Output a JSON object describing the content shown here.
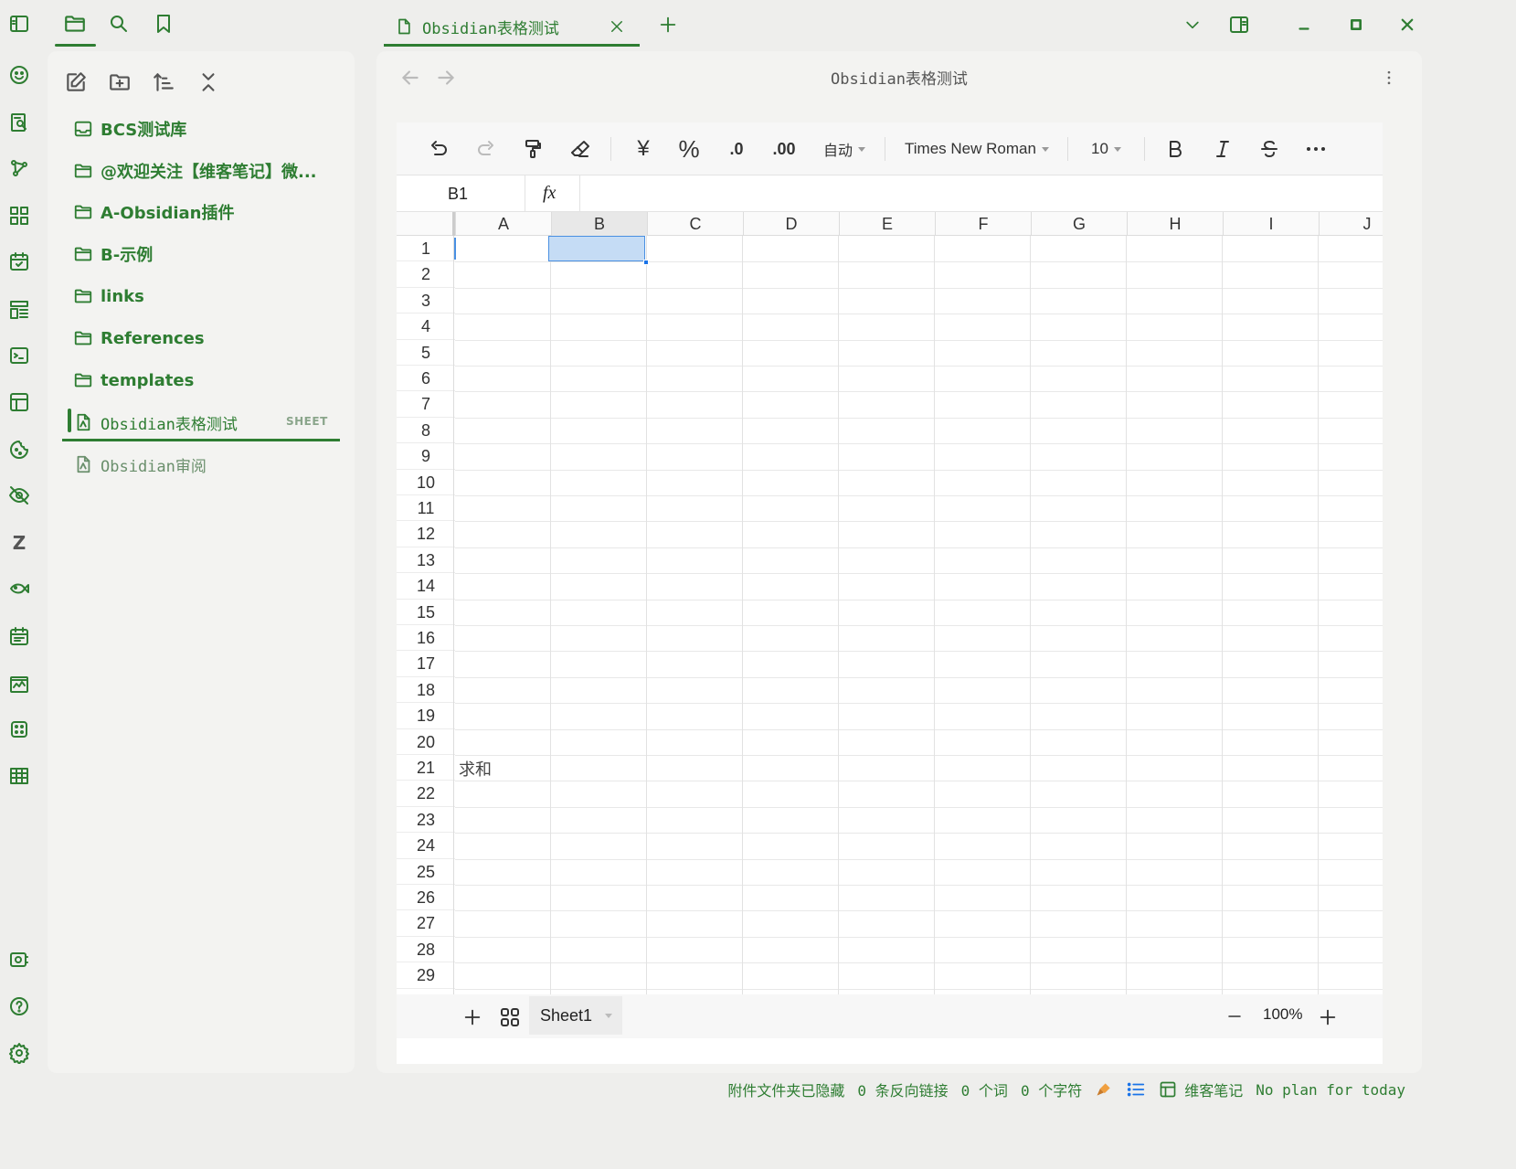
{
  "sidebar_left": {
    "tabs": [
      "files-icon",
      "search-icon",
      "bookmark-icon"
    ],
    "nav_icons": [
      "new-note-icon",
      "new-folder-icon",
      "sort-icon",
      "collapse-icon"
    ],
    "items": [
      {
        "label": "BCS测试库",
        "type": "vault"
      },
      {
        "label": "@欢迎关注【维客笔记】微...",
        "type": "folder"
      },
      {
        "label": "A-Obsidian插件",
        "type": "folder"
      },
      {
        "label": "B-示例",
        "type": "folder"
      },
      {
        "label": "links",
        "type": "folder"
      },
      {
        "label": "References",
        "type": "folder"
      },
      {
        "label": "templates",
        "type": "folder"
      },
      {
        "label": "Obsidian表格测试",
        "type": "file",
        "badge": "SHEET",
        "active": true
      },
      {
        "label": "Obsidian审阅",
        "type": "file"
      }
    ]
  },
  "tab": {
    "title": "Obsidian表格测试"
  },
  "view": {
    "title": "Obsidian表格测试"
  },
  "toolbar": {
    "number_format": "自动",
    "font": "Times New Roman",
    "font_size": "10",
    "currency": "¥",
    "percent": "%",
    "dec_less": ".0",
    "dec_more": ".00"
  },
  "formula_bar": {
    "cell_ref": "B1",
    "fx": "fx"
  },
  "grid": {
    "columns": [
      "A",
      "B",
      "C",
      "D",
      "E",
      "F",
      "G",
      "H",
      "I",
      "J"
    ],
    "rows": [
      "1",
      "2",
      "3",
      "4",
      "5",
      "6",
      "7",
      "8",
      "9",
      "10",
      "11",
      "12",
      "13",
      "14",
      "15",
      "16",
      "17",
      "18",
      "19",
      "20",
      "21",
      "22",
      "23",
      "24",
      "25",
      "26",
      "27",
      "28",
      "29"
    ],
    "selected_cell": "B1",
    "cells": {
      "A21": "求和"
    }
  },
  "footer": {
    "sheet_name": "Sheet1",
    "zoom": "100%"
  },
  "status": {
    "attachments": "附件文件夹已隐藏",
    "backlinks": "0 条反向链接",
    "words": "0 个词",
    "chars": "0 个字符",
    "plugin": "维客笔记",
    "plan": "No plan for today"
  },
  "colors": {
    "accent": "#2e7d32",
    "selection": "#c5dcf5"
  }
}
